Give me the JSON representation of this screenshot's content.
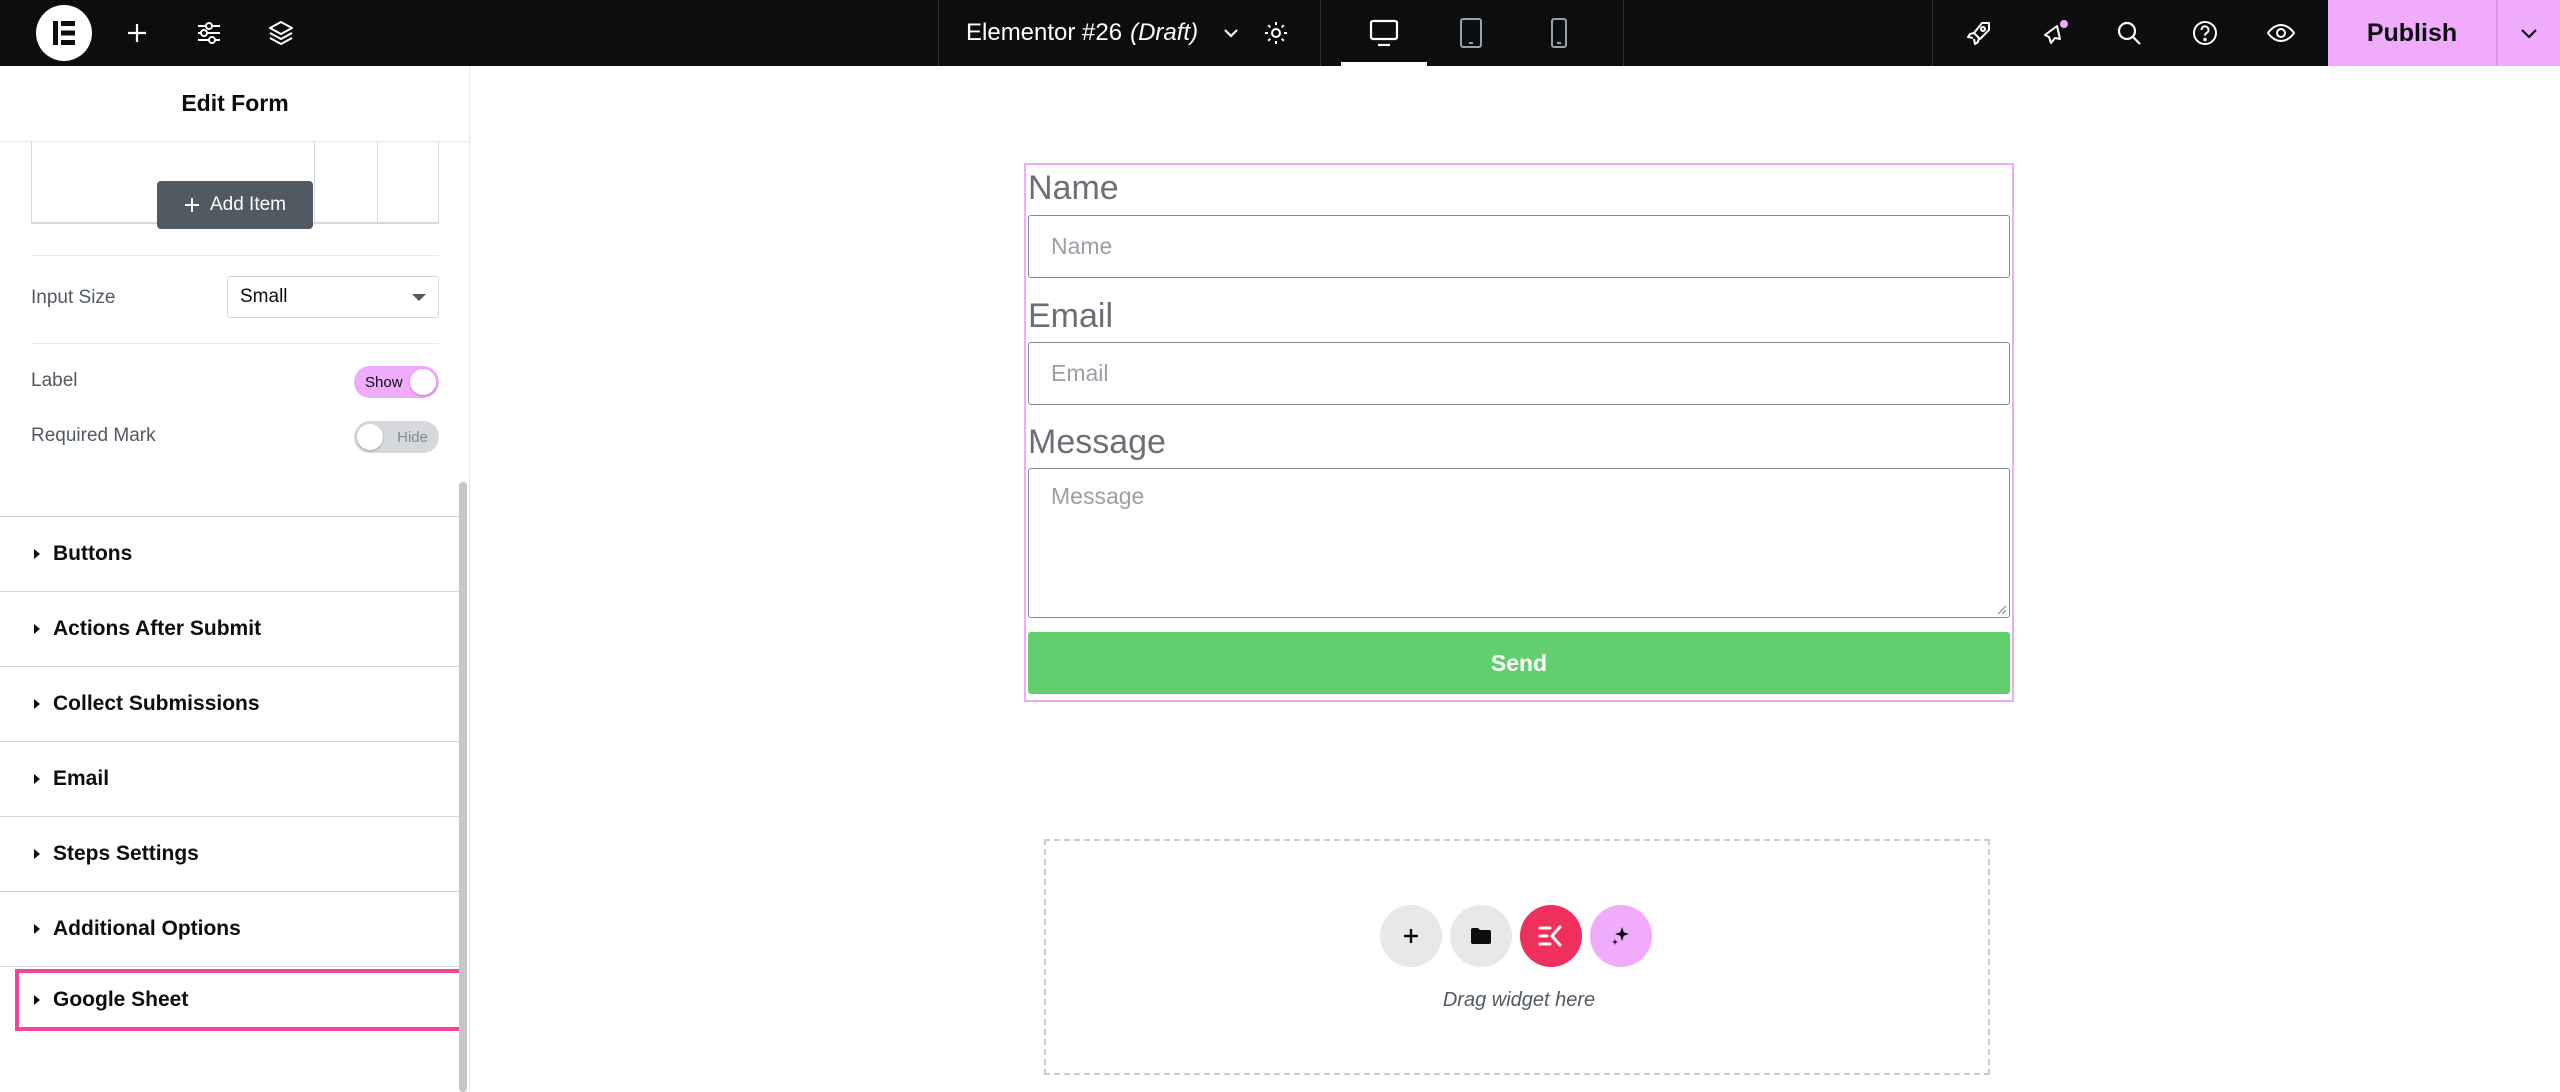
{
  "topbar": {
    "doc_title": "Elementor #26",
    "doc_status": "(Draft)",
    "publish_label": "Publish",
    "icons": [
      "elementor-logo-icon",
      "plus-icon",
      "sliders-icon",
      "layers-icon",
      "chevron-down-icon",
      "gear-icon",
      "desktop-icon",
      "tablet-icon",
      "mobile-icon",
      "rocket-icon",
      "notifications-icon",
      "search-icon",
      "help-icon",
      "eye-icon"
    ],
    "notification_dot_color": "#f0abfc"
  },
  "panel": {
    "title": "Edit Form",
    "add_item_label": "Add Item",
    "input_size_label": "Input Size",
    "input_size_value": "Small",
    "label_control": "Label",
    "label_toggle": "Show",
    "required_mark_control": "Required Mark",
    "required_toggle": "Hide",
    "sections": [
      {
        "label": "Buttons"
      },
      {
        "label": "Actions After Submit"
      },
      {
        "label": "Collect Submissions"
      },
      {
        "label": "Email"
      },
      {
        "label": "Steps Settings"
      },
      {
        "label": "Additional Options"
      },
      {
        "label": "Google Sheet"
      }
    ],
    "highlighted_section": "Google Sheet",
    "highlight_color": "#f0459a"
  },
  "form": {
    "name_label": "Name",
    "name_placeholder": "Name",
    "email_label": "Email",
    "email_placeholder": "Email",
    "message_label": "Message",
    "message_placeholder": "Message",
    "send_label": "Send",
    "send_color": "#61ce70"
  },
  "dropzone": {
    "text": "Drag widget here"
  },
  "colors": {
    "accent": "#f0abfc",
    "topbar_bg": "#0c0d0e",
    "kit_button": "#f0305c"
  }
}
